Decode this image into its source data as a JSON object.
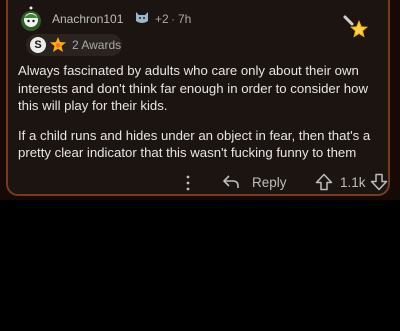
{
  "comment": {
    "username": "Anachron101",
    "karma_delta": "+2",
    "separator": "·",
    "age": "7h",
    "awards_label": "2 Awards",
    "silver_badge_letter": "S",
    "paragraphs": [
      "Always fascinated by adults who care only about their own interests and don't think far enough in order to consider how this will play for their kids.",
      "If a child runs and hides under an object in fear, then that's a pretty clear indicator that this wasn't fucking funny to them"
    ]
  },
  "actions": {
    "more_icon": "more-vertical-icon",
    "reply_label": "Reply",
    "vote_count": "1.1k"
  },
  "colors": {
    "card_border": "#7a3a1c",
    "card_background": "#1c1410",
    "text": "#e6e6e6",
    "muted": "#a8a8a8"
  }
}
